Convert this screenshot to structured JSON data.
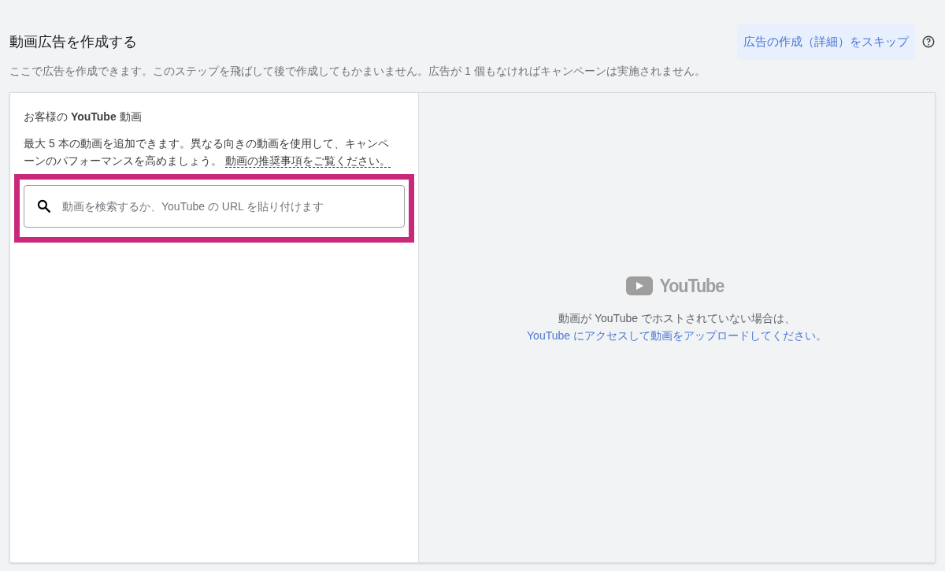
{
  "header": {
    "title": "動画広告を作成する",
    "skip_button": "広告の作成（詳細）をスキップ",
    "description": "ここで広告を作成できます。このステップを飛ばして後で作成してもかまいません。広告が 1 個もなければキャンペーンは実施されません。"
  },
  "left_panel": {
    "heading": "お客様の **YouTube** 動画",
    "text": "最大 5 本の動画を追加できます。異なる向きの動画を使用して、キャンペーンのパフォーマンスを高めましょう。",
    "link": "動画の推奨事項をご覧ください。",
    "search": {
      "placeholder": "動画を検索するか、YouTube の URL を貼り付けます"
    }
  },
  "right_panel": {
    "logo_text": "YouTube",
    "text": "動画が YouTube でホストされていない場合は、",
    "link": "YouTube にアクセスして動画をアップロードしてください。"
  }
}
